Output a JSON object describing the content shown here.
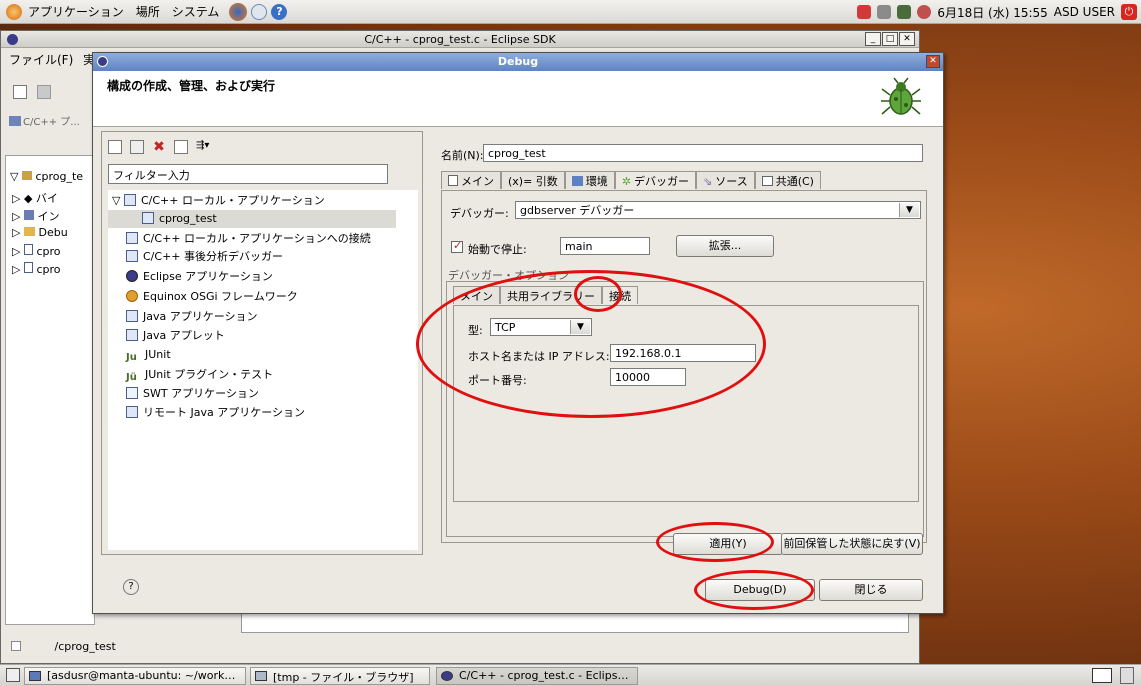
{
  "top_panel": {
    "menus": [
      "アプリケーション",
      "場所",
      "システム"
    ],
    "clock": "6月18日 (水) 15:55",
    "user": "ASD USER"
  },
  "eclipse": {
    "title": "C/C++ - cprog_test.c - Eclipse SDK",
    "menu": [
      "ファイル(F)",
      "実"
    ],
    "perspective_label": "C/C++ プ...",
    "tree": [
      "cprog_te",
      "バイ",
      "イン",
      "Debu",
      "cpro",
      "cpro"
    ],
    "status_path": "/cprog_test"
  },
  "dialog": {
    "title": "Debug",
    "header": "構成の作成、管理、および実行",
    "filter_placeholder": "フィルター入力",
    "config_tree": [
      "C/C++ ローカル・アプリケーション",
      "cprog_test",
      "C/C++ ローカル・アプリケーションへの接続",
      "C/C++ 事後分析デバッガー",
      "Eclipse アプリケーション",
      "Equinox OSGi フレームワーク",
      "Java アプリケーション",
      "Java アプレット",
      "JUnit",
      "JUnit プラグイン・テスト",
      "SWT アプリケーション",
      "リモート Java アプリケーション"
    ],
    "name_label": "名前(N):",
    "name_value": "cprog_test",
    "tabs": [
      "メイン",
      "(x)= 引数",
      "環境",
      "デバッガー",
      "ソース",
      "共通(C)"
    ],
    "debugger_label": "デバッガー:",
    "debugger_value": "gdbserver デバッガー",
    "stop_label": "始動で停止:",
    "stop_value": "main",
    "expand_button": "拡張...",
    "options_group": "デバッガー・オプション",
    "subtabs": [
      "メイン",
      "共用ライブラリー",
      "接続"
    ],
    "type_label": "型:",
    "type_value": "TCP",
    "host_label": "ホスト名または IP アドレス:",
    "host_value": "192.168.0.1",
    "port_label": "ポート番号:",
    "port_value": "10000",
    "apply_button": "適用(Y)",
    "revert_button": "前回保管した状態に戻す(V)",
    "debug_button": "Debug(D)",
    "close_button": "閉じる",
    "help_icon": "?"
  },
  "taskbar": {
    "tasks": [
      "[asdusr@manta-ubuntu: ~/work…",
      "[tmp - ファイル・ブラウザ]",
      "C/C++ - cprog_test.c - Eclips…"
    ]
  },
  "colors": {
    "highlight_ellipse": "#e01010",
    "title_blue": "#5d83c4"
  }
}
